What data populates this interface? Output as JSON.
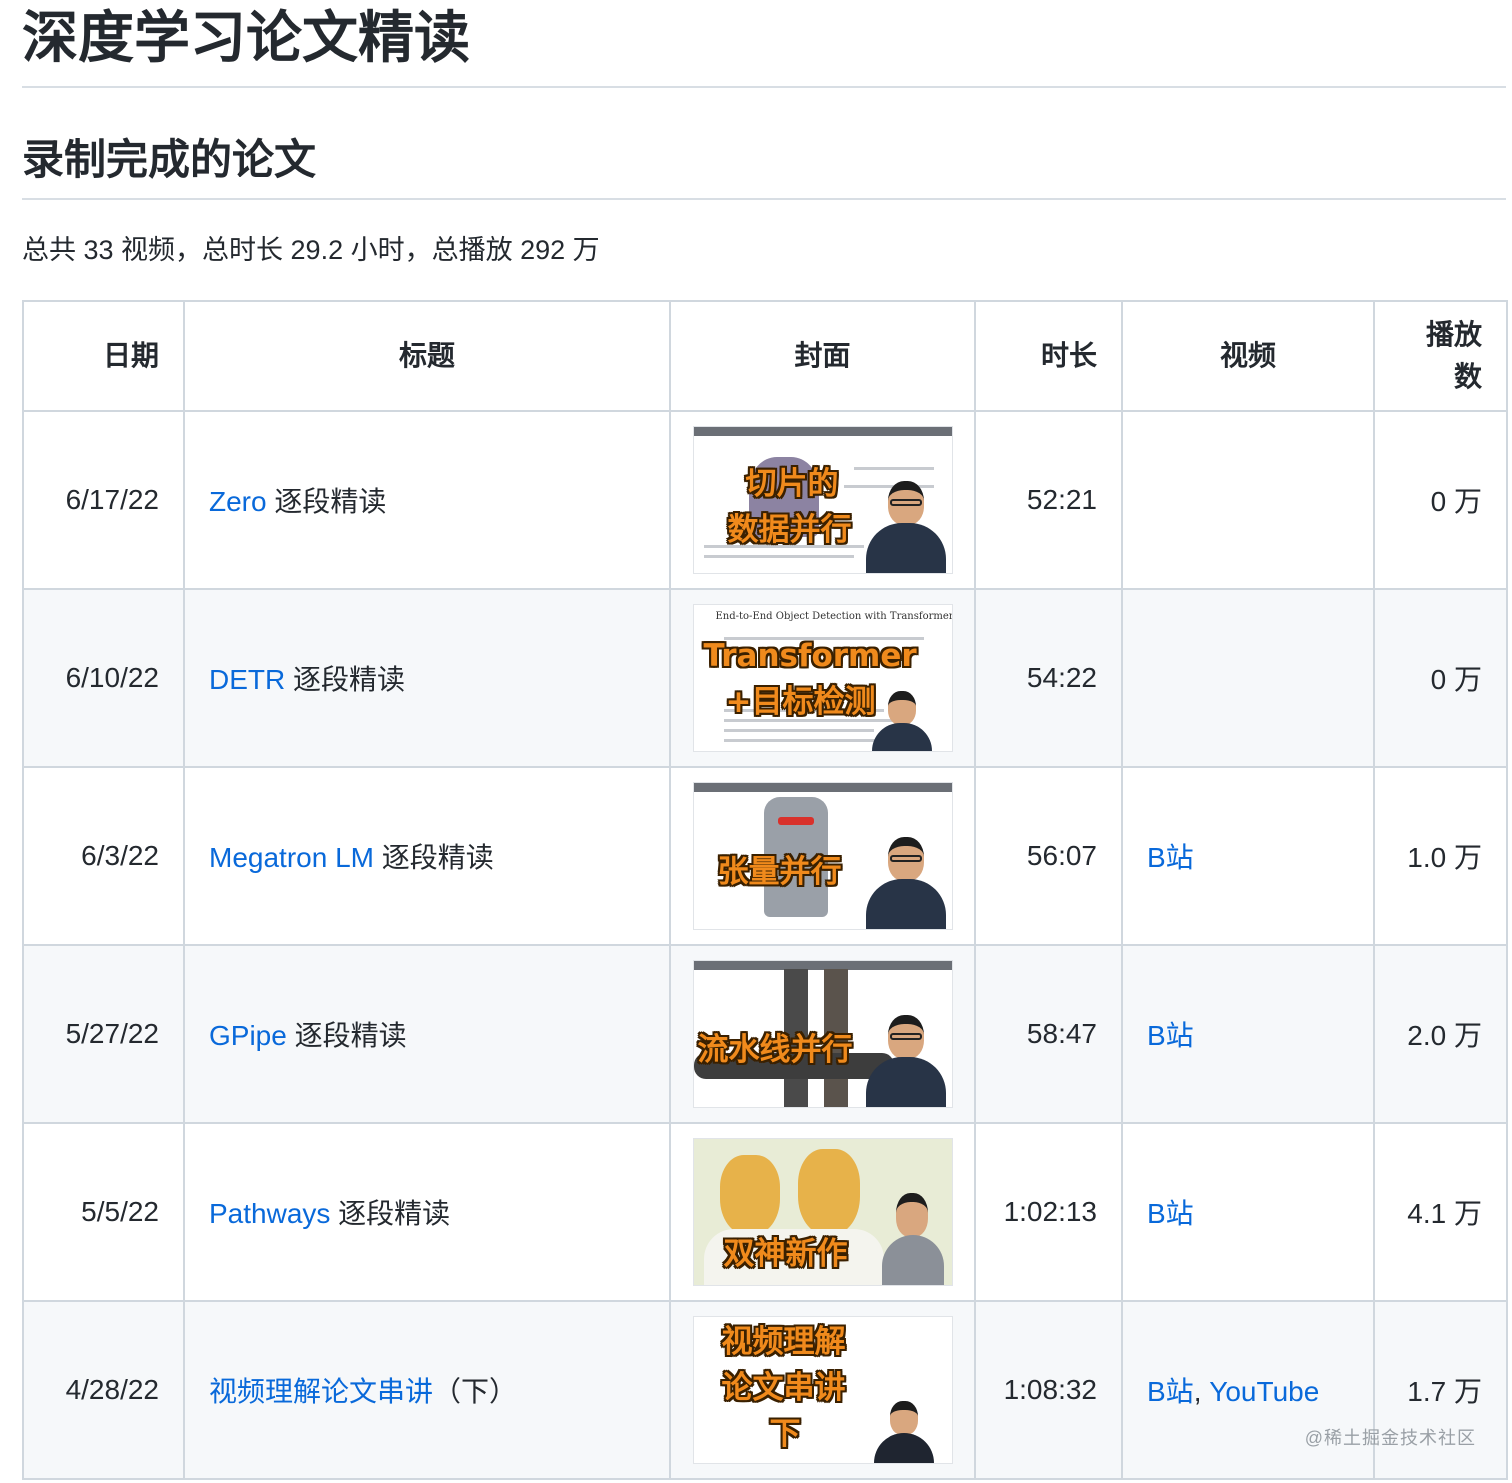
{
  "page": {
    "title": "深度学习论文精读",
    "section_title": "录制完成的论文",
    "summary": "总共 33 视频，总时长 29.2 小时，总播放 292 万"
  },
  "table": {
    "headers": {
      "date": "日期",
      "title": "标题",
      "cover": "封面",
      "duration": "时长",
      "video": "视频",
      "plays": "播放\n数"
    },
    "rows": [
      {
        "date": "6/17/22",
        "title_link": "Zero",
        "title_suffix": " 逐段精读",
        "cover_text": [
          "切片的",
          "数据并行"
        ],
        "duration": "52:21",
        "video_links": [],
        "plays": "0 万"
      },
      {
        "date": "6/10/22",
        "title_link": "DETR",
        "title_suffix": " 逐段精读",
        "cover_paper_title": "End-to-End Object Detection with Transformers",
        "cover_text": [
          "Transformer",
          "+目标检测"
        ],
        "duration": "54:22",
        "video_links": [],
        "plays": "0 万"
      },
      {
        "date": "6/3/22",
        "title_link": "Megatron LM",
        "title_suffix": " 逐段精读",
        "cover_text": [
          "张量并行"
        ],
        "duration": "56:07",
        "video_links": [
          "B站"
        ],
        "plays": "1.0 万"
      },
      {
        "date": "5/27/22",
        "title_link": "GPipe",
        "title_suffix": " 逐段精读",
        "cover_text": [
          "流水线并行"
        ],
        "duration": "58:47",
        "video_links": [
          "B站"
        ],
        "plays": "2.0 万"
      },
      {
        "date": "5/5/22",
        "title_link": "Pathways",
        "title_suffix": " 逐段精读",
        "cover_text": [
          "双神新作"
        ],
        "duration": "1:02:13",
        "video_links": [
          "B站"
        ],
        "plays": "4.1 万"
      },
      {
        "date": "4/28/22",
        "title_link": "视频理解论文串讲",
        "title_suffix": "（下）",
        "cover_text": [
          "视频理解",
          "论文串讲",
          "下"
        ],
        "duration": "1:08:32",
        "video_links": [
          "B站",
          ", ",
          "YouTube"
        ],
        "plays": "1.7 万"
      }
    ]
  },
  "watermark": "@稀土掘金技术社区",
  "colors": {
    "link": "#0969da",
    "border": "#d0d7de",
    "stripe": "#f6f8fa",
    "cover_text": "#f08a1c"
  }
}
